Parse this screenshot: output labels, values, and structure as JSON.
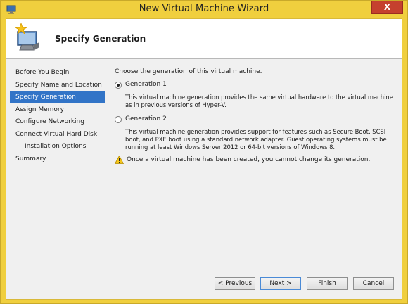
{
  "window": {
    "title": "New Virtual Machine Wizard",
    "close_label": "X",
    "accent_color": "#f0cf3e"
  },
  "header": {
    "title": "Specify Generation",
    "icon": "monitor-star-icon"
  },
  "nav": {
    "items": [
      {
        "label": "Before You Begin",
        "selected": false,
        "indent": false
      },
      {
        "label": "Specify Name and Location",
        "selected": false,
        "indent": false
      },
      {
        "label": "Specify Generation",
        "selected": true,
        "indent": false
      },
      {
        "label": "Assign Memory",
        "selected": false,
        "indent": false
      },
      {
        "label": "Configure Networking",
        "selected": false,
        "indent": false
      },
      {
        "label": "Connect Virtual Hard Disk",
        "selected": false,
        "indent": false
      },
      {
        "label": "Installation Options",
        "selected": false,
        "indent": true
      },
      {
        "label": "Summary",
        "selected": false,
        "indent": false
      }
    ]
  },
  "content": {
    "intro": "Choose the generation of this virtual machine.",
    "options": [
      {
        "label": "Generation 1",
        "checked": true,
        "description": "This virtual machine generation provides the same virtual hardware to the virtual machine as in previous versions of Hyper-V."
      },
      {
        "label": "Generation 2",
        "checked": false,
        "description": "This virtual machine generation provides support for features such as Secure Boot, SCSI boot, and PXE boot using a standard network adapter. Guest operating systems must be running at least Windows Server 2012 or 64-bit versions of Windows 8."
      }
    ],
    "warning": "Once a virtual machine has been created, you cannot change its generation."
  },
  "buttons": {
    "previous": "< Previous",
    "next": "Next >",
    "finish": "Finish",
    "cancel": "Cancel"
  }
}
